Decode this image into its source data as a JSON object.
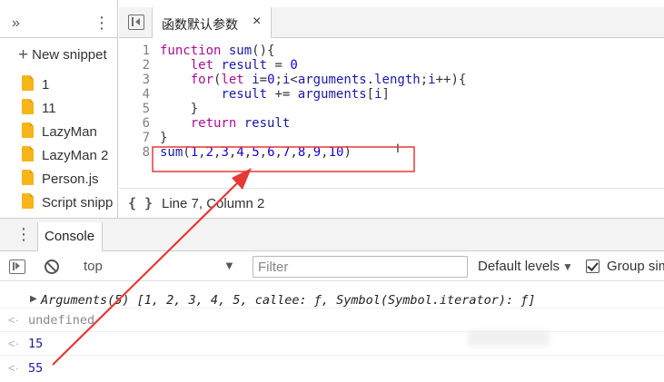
{
  "sidebar": {
    "more_tabs_glyph": "»",
    "new_snippet_label": "New snippet",
    "files": [
      {
        "label": "1"
      },
      {
        "label": "11"
      },
      {
        "label": "LazyMan"
      },
      {
        "label": "LazyMan 2"
      },
      {
        "label": "Person.js"
      },
      {
        "label": "Script snipp"
      }
    ]
  },
  "editor": {
    "tab_title": "函数默认参数",
    "tab_close": "×",
    "line_numbers": [
      "1",
      "2",
      "3",
      "4",
      "5",
      "6",
      "7",
      "8"
    ],
    "code_lines": [
      "function sum(){",
      "    let result = 0",
      "    for(let i=0;i<arguments.length;i++){",
      "        result += arguments[i]",
      "    }",
      "    return result",
      "}",
      "sum(1,2,3,4,5,6,7,8,9,10)"
    ],
    "footer_braces": "{ }",
    "cursor_position": "Line 7, Column 2"
  },
  "console": {
    "tab_label": "Console",
    "context": "top",
    "filter_placeholder": "Filter",
    "levels_label": "Default levels",
    "group_label": "Group similar",
    "group_checked": true,
    "messages": [
      {
        "text": "Arguments(5) [1, 2, 3, 4, 5, callee: ƒ, Symbol(Symbol.iterator): ƒ]"
      },
      {
        "text": "undefined"
      },
      {
        "text": "15"
      },
      {
        "text": "55"
      }
    ]
  },
  "annotation": {
    "highlight_color": "#e53935"
  }
}
